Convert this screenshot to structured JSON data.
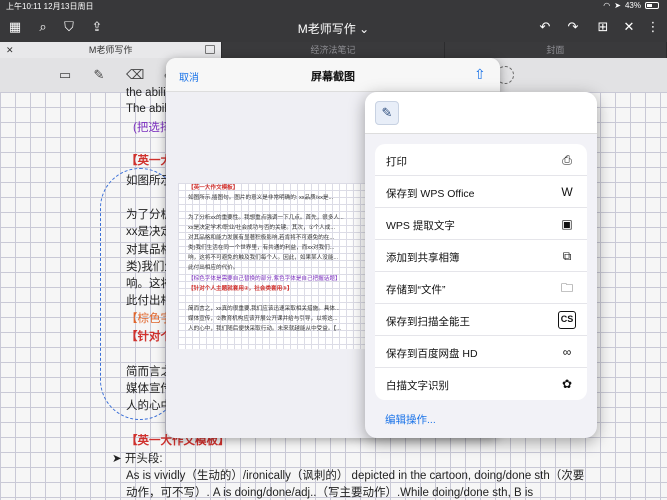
{
  "statusbar": {
    "time": "上午10:11",
    "date": "12月13日周日",
    "battery": "43%"
  },
  "appbar": {
    "title": "M老师写作"
  },
  "tabs": [
    {
      "label": "M老师写作"
    },
    {
      "label": "经济法笔记"
    },
    {
      "label": "封面"
    }
  ],
  "note": {
    "lines": [
      "the abili",
      "The abili",
      "(把选择",
      "【英一大",
      "如图所示",
      "为了分析",
      "xx是决定",
      "对其品格",
      "类)我们生",
      "响。这将",
      "此付出相",
      "【棕色字",
      "【针对个",
      "简而言之",
      "媒体宣传",
      "人的心中",
      "【英一大作文模板】",
      "开头段:",
      "As is vividly（生动的）/ironically（讽刺的） depicted in the cartoon, doing/done sth（次要",
      "动作，可不写）. A is doing/done/adj..（写主要动作）.While doing/done sth, B is"
    ]
  },
  "sheet": {
    "cancel": "取消",
    "title": "屏幕截图",
    "thumb_lines": [
      "【英一大作文模板】",
      "如图所示,插图句。图片的意义是非常明确的: xx品质/xx是...",
      "为了分析xx的重要性。我想重点强调一下几点。首先，很多人...",
      "xx是决定学术/职业/社会成功与否的关键。其次，①个人成...",
      "对其品格和能力发展有显著积极影响,若肯将不可避免的在...",
      "类)我们生活在同一个世界里，有共通的利益，而xx对我们...",
      "响，这将不可避免的触及我们每个人。因此，如果某人没能...",
      "此付出相应的代价。",
      "【棕色字体是需要自己替换的部分,紫色字体是自己把握话题】",
      "【针对个人主题就套用②，社会类套用③】",
      "简而言之，xx真的很重要,我们应该迅速采取相关措施。具体...",
      "媒体宣传，②教育机构应该开展公开课并给与引导，以将这...",
      "人的心中，我们随后便快采取行动。未来就越能从中受益。【..."
    ]
  },
  "share": {
    "items_group1": [
      {
        "label": "打印",
        "icon": "printer-icon"
      },
      {
        "label": "保存到 WPS Office",
        "icon": "wps-icon"
      },
      {
        "label": "WPS 提取文字",
        "icon": "text-extract-icon"
      },
      {
        "label": "添加到共享相簿",
        "icon": "shared-album-icon"
      },
      {
        "label": "存储到“文件”",
        "icon": "folder-icon"
      },
      {
        "label": "保存到扫描全能王",
        "icon": "camscanner-icon",
        "glyph": "CS"
      },
      {
        "label": "保存到百度网盘 HD",
        "icon": "baidu-netdisk-icon"
      },
      {
        "label": "白描文字识别",
        "icon": "baimiao-icon"
      }
    ],
    "edit_actions": "编辑操作..."
  }
}
